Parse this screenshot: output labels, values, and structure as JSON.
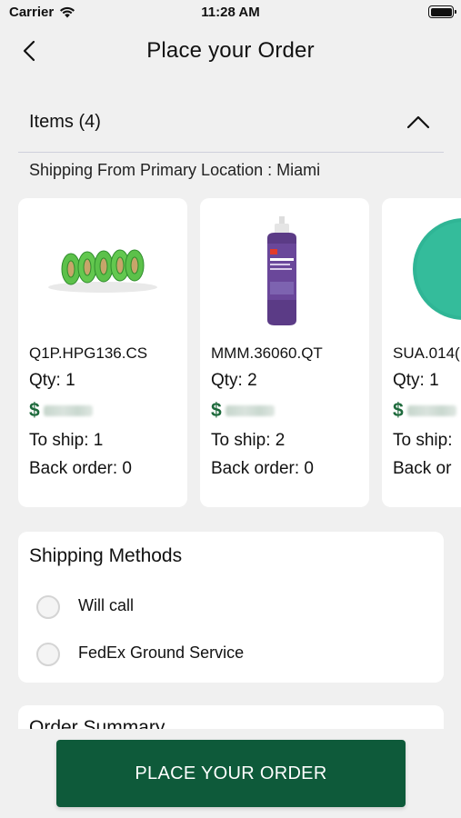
{
  "status": {
    "carrier": "Carrier",
    "time": "11:28 AM"
  },
  "nav": {
    "title": "Place your Order"
  },
  "items": {
    "title": "Items (4)",
    "ship_from": "Shipping From Primary Location : Miami"
  },
  "cards": [
    {
      "sku": "Q1P.HPG136.CS",
      "qty": "Qty: 1",
      "currency": "$",
      "to_ship": "To ship: 1",
      "back_order": "Back order: 0",
      "image": "green-tape-rolls"
    },
    {
      "sku": "MMM.36060.QT",
      "qty": "Qty: 2",
      "currency": "$",
      "to_ship": "To ship: 2",
      "back_order": "Back order: 0",
      "image": "purple-compound-bottle"
    },
    {
      "sku": "SUA.014(",
      "qty": "Qty: 1",
      "currency": "$",
      "to_ship": "To ship:",
      "back_order": "Back or",
      "image": "teal-sanding-disc"
    }
  ],
  "shipping": {
    "title": "Shipping Methods",
    "options": [
      {
        "label": "Will call"
      },
      {
        "label": "FedEx Ground Service"
      }
    ]
  },
  "summary": {
    "title": "Order Summary"
  },
  "place_order": {
    "label": "PLACE YOUR ORDER"
  },
  "colors": {
    "accent": "#0e5a3a",
    "price": "#1e6a3c",
    "background": "#f0f0f0"
  }
}
